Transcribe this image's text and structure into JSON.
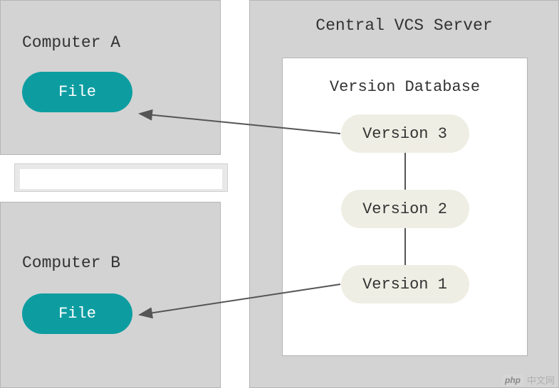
{
  "computers": [
    {
      "title": "Computer A",
      "file_label": "File"
    },
    {
      "title": "Computer B",
      "file_label": "File"
    }
  ],
  "server": {
    "title": "Central VCS Server",
    "database": {
      "title": "Version Database",
      "versions": [
        "Version 3",
        "Version 2",
        "Version 1"
      ]
    }
  },
  "colors": {
    "box_bg": "#d3d3d3",
    "file_pill": "#0d9da1",
    "version_pill": "#efeee4"
  },
  "watermark": {
    "badge": "php",
    "text": "中文网"
  }
}
